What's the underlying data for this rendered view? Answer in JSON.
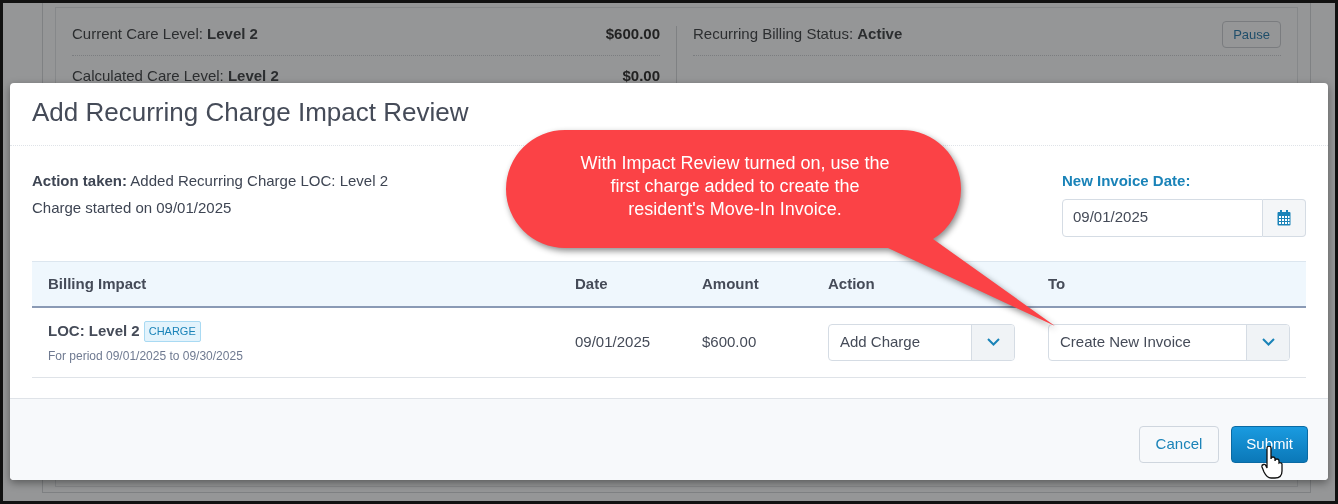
{
  "background": {
    "left_rows": [
      {
        "text": "Current Care Level: **Level 2**",
        "amount": "$600.00"
      },
      {
        "text": "Calculated Care Level: **Level 2**",
        "amount": "$0.00"
      }
    ],
    "right_rows": [
      {
        "text": "Recurring Billing Status: **Active**",
        "button": "Pause"
      }
    ]
  },
  "modal": {
    "title": "Add Recurring Charge Impact Review",
    "action_taken": "**Action taken:** Added Recurring Charge LOC: Level 2",
    "charge_started": "Charge started on 09/01/2025",
    "invoice_date": {
      "label": "New Invoice Date:",
      "value": "09/01/2025"
    },
    "table": {
      "columns": [
        "Billing Impact",
        "Date",
        "Amount",
        "Action",
        "To"
      ],
      "rows": [
        {
          "name": "LOC: Level 2",
          "tag": "CHARGE",
          "period": "For period 09/01/2025 to 09/30/2025",
          "date": "09/01/2025",
          "amount": "$600.00",
          "action": "Add Charge",
          "to": "Create New Invoice"
        }
      ]
    },
    "buttons": [
      {
        "label": "Cancel",
        "kind": "secondary"
      },
      {
        "label": "Submit",
        "kind": "primary"
      }
    ]
  },
  "callout": {
    "text": "With Impact Review turned on, use the first charge added to create the resident's Move-In Invoice."
  }
}
